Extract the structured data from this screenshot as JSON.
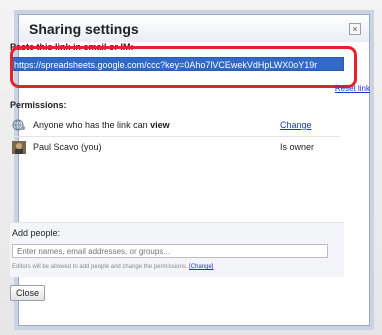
{
  "dialog": {
    "title": "Sharing settings",
    "close_glyph": "×"
  },
  "link_section": {
    "label": "Paste this link in email or IM:",
    "link_value": "https://spreadsheets.google.com/ccc?key=0Aho7lVCEwekVdHpLWX0oY19r",
    "reset_label": "Reset link",
    "highlight_color": "#e3232a",
    "selection_color": "#3169c6"
  },
  "permissions": {
    "label": "Permissions:",
    "rows": [
      {
        "icon": "globe-people-icon",
        "text_prefix": "Anyone who has the link can ",
        "text_bold": "view",
        "right_label": "Change"
      },
      {
        "icon": "user-avatar-icon",
        "text": "Paul Scavo (you)",
        "right_label": "Is owner"
      }
    ]
  },
  "add_people": {
    "label": "Add people:",
    "placeholder": "Enter names, email addresses, or groups...",
    "note_text": "Editors will be allowed to add people and change the permissions.",
    "note_link": "[Change]"
  },
  "footer": {
    "close_label": "Close"
  },
  "colors": {
    "link_blue": "#1a37c9",
    "dialog_border": "#9aa9c4"
  }
}
